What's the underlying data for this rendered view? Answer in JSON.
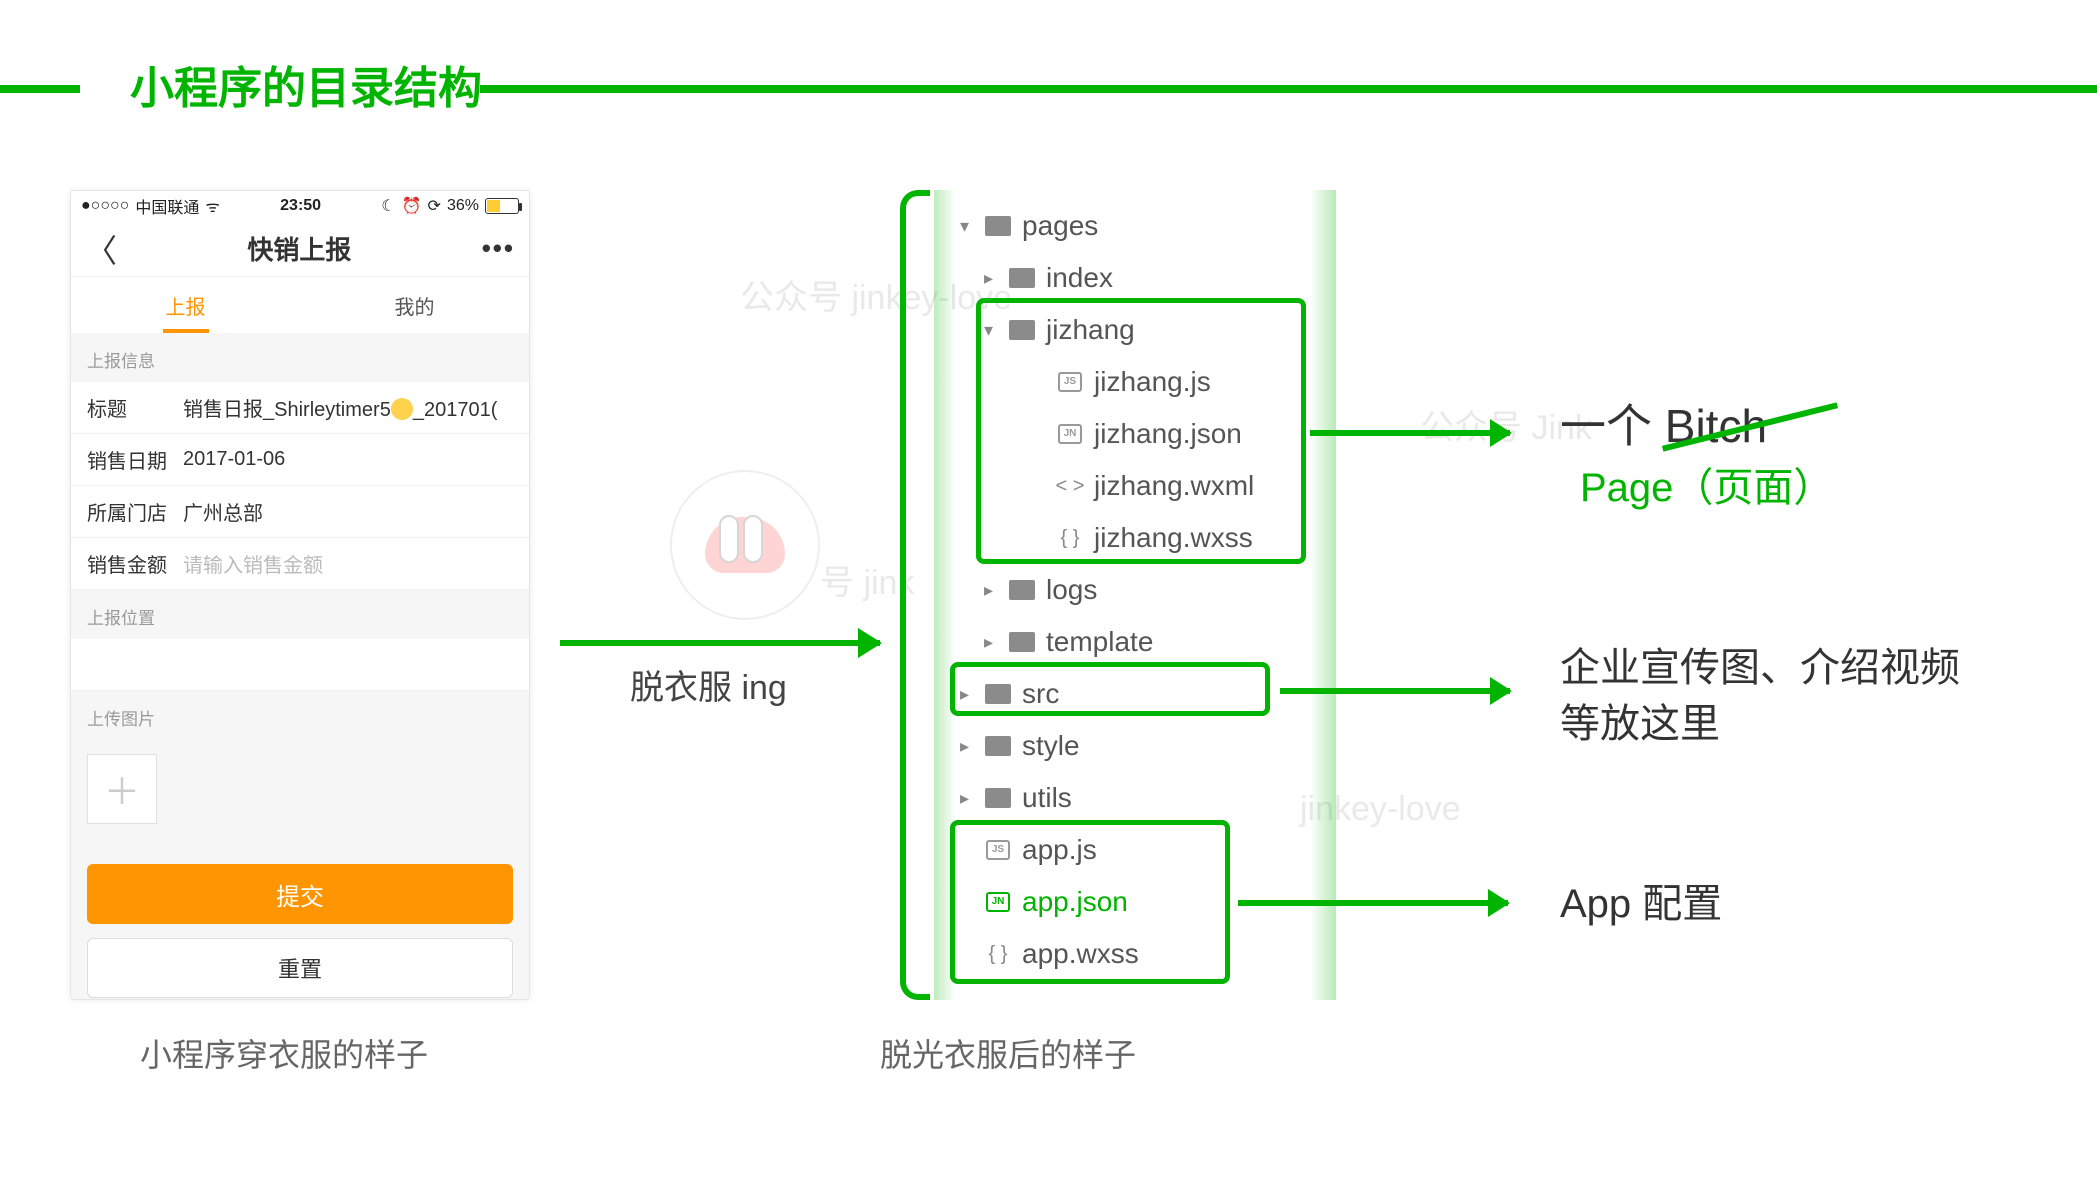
{
  "title": "小程序的目录结构",
  "phone": {
    "status": {
      "carrier": "中国联通",
      "time": "23:50",
      "battery": "36%"
    },
    "nav": {
      "title": "快销上报",
      "more": "•••"
    },
    "tabs": {
      "report": "上报",
      "mine": "我的"
    },
    "sections": {
      "info_label": "上报信息",
      "title_label": "标题",
      "title_value_a": "销售日报_Shirleytimer5",
      "title_value_b": "_201701(",
      "date_label": "销售日期",
      "date_value": "2017-01-06",
      "store_label": "所属门店",
      "store_value": "广州总部",
      "amount_label": "销售金额",
      "amount_placeholder": "请输入销售金额",
      "loc_label": "上报位置",
      "pic_label": "上传图片"
    },
    "buttons": {
      "submit": "提交",
      "reset": "重置"
    }
  },
  "captions": {
    "with_clothes": "小程序穿衣服的样子",
    "undressing": "脱衣服 ing",
    "naked": "脱光衣服后的样子"
  },
  "tree": {
    "pages": "pages",
    "index": "index",
    "jizhang": "jizhang",
    "jizhang_js": "jizhang.js",
    "jizhang_json": "jizhang.json",
    "jizhang_wxml": "jizhang.wxml",
    "jizhang_wxss": "jizhang.wxss",
    "logs": "logs",
    "template": "template",
    "src": "src",
    "style": "style",
    "utils": "utils",
    "app_js": "app.js",
    "app_json": "app.json",
    "app_wxss": "app.wxss"
  },
  "annotations": {
    "page_strike": "一个 Bitch",
    "page_correct": "Page（页面）",
    "src_note": "企业宣传图、介绍视频等放这里",
    "app_note": "App 配置"
  },
  "watermarks": {
    "w1": "公众号 jinkey-love",
    "w2": "号 jink",
    "w3": "公众号 Jink",
    "w4": "jinkey-love"
  }
}
